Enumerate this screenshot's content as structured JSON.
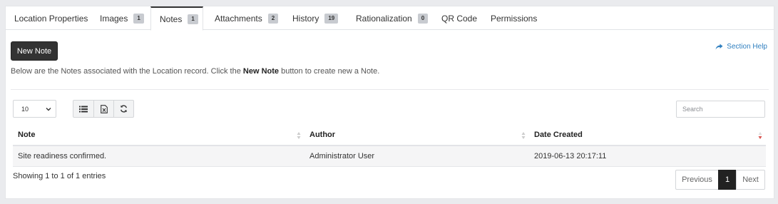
{
  "tabs": [
    {
      "label": "Location Properties",
      "badge": null
    },
    {
      "label": "Images",
      "badge": "1"
    },
    {
      "label": "Notes",
      "badge": "1",
      "active": true
    },
    {
      "label": "Attachments",
      "badge": "2"
    },
    {
      "label": "History",
      "badge": "19"
    },
    {
      "label": "Rationalization",
      "badge": "0"
    },
    {
      "label": "QR Code",
      "badge": null
    },
    {
      "label": "Permissions",
      "badge": null
    }
  ],
  "toolbar": {
    "new_note_label": "New Note",
    "section_help_label": "Section Help"
  },
  "description": {
    "before": "Below are the Notes associated with the Location record. Click the ",
    "bold": "New Note",
    "after": " button to create new a Note."
  },
  "controls": {
    "page_size": "10",
    "search_placeholder": "Search",
    "buttons": [
      "list-icon",
      "excel-export-icon",
      "refresh-icon"
    ]
  },
  "table": {
    "columns": [
      "Note",
      "Author",
      "Date Created"
    ],
    "rows": [
      {
        "note": "Site readiness confirmed.",
        "author": "Administrator User",
        "date_created": "2019-06-13 20:17:11"
      }
    ]
  },
  "footer": {
    "info": "Showing 1 to 1 of 1 entries",
    "previous": "Previous",
    "current_page": "1",
    "next": "Next"
  },
  "colors": {
    "accent_dark": "#333333",
    "link": "#2f7fbf",
    "sort_active": "#d9534f"
  }
}
